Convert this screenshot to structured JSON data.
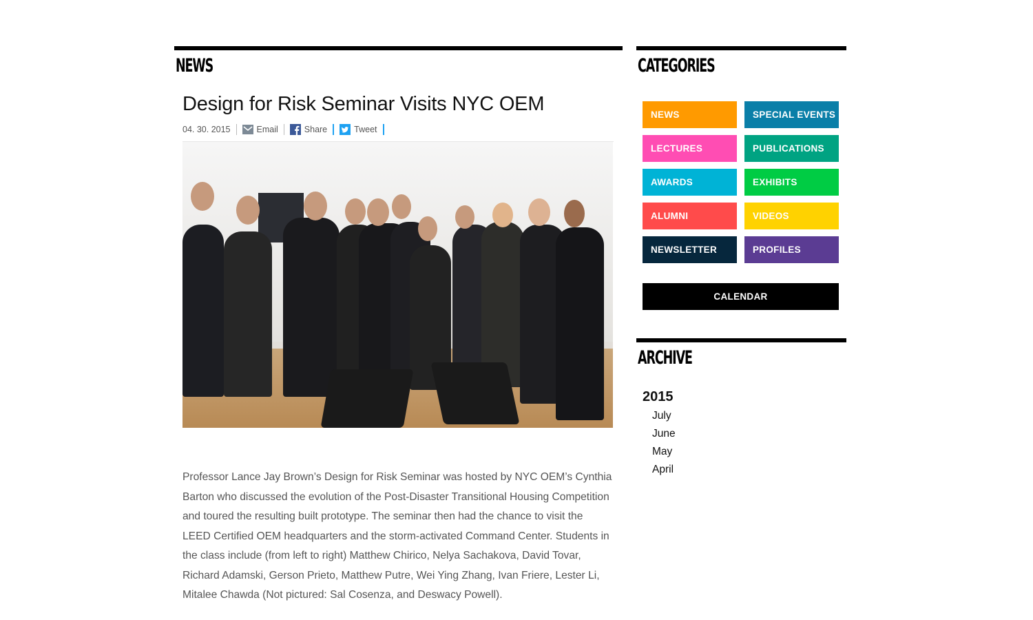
{
  "news": {
    "section_title": "NEWS",
    "article": {
      "title": "Design for Risk Seminar Visits NYC OEM",
      "date": "04. 30. 2015",
      "email_label": "Email",
      "share_label": "Share",
      "tweet_label": "Tweet",
      "body": "Professor Lance Jay Brown’s Design for Risk Seminar was hosted by NYC OEM’s Cynthia Barton who discussed the evolution of the Post-Disaster Transitional Housing Competition and toured the resulting built prototype. The seminar then had the chance to visit the LEED Certified OEM headquarters and the storm-activated Command Center. Students in the class include (from left to right) Matthew Chirico, Nelya Sachakova, David Tovar, Richard Adamski, Gerson Prieto, Matthew Putre, Wei Ying Zhang, Ivan Friere, Lester Li, Mitalee Chawda (Not pictured: Sal Cosenza, and Deswacy Powell)."
    }
  },
  "sidebar": {
    "categories_title": "CATEGORIES",
    "categories": [
      {
        "label": "NEWS",
        "color": "#ff9a00"
      },
      {
        "label": "SPECIAL EVENTS",
        "color": "#0a7fa8"
      },
      {
        "label": "LECTURES",
        "color": "#ff4db3"
      },
      {
        "label": "PUBLICATIONS",
        "color": "#00a382"
      },
      {
        "label": "AWARDS",
        "color": "#00b3d6"
      },
      {
        "label": "EXHIBITS",
        "color": "#00cc44"
      },
      {
        "label": "ALUMNI",
        "color": "#ff4b4b"
      },
      {
        "label": "VIDEOS",
        "color": "#ffd200"
      },
      {
        "label": "NEWSLETTER",
        "color": "#06273d"
      },
      {
        "label": "PROFILES",
        "color": "#5b3c93"
      }
    ],
    "calendar_label": "CALENDAR",
    "archive_title": "ARCHIVE",
    "archive_year": "2015",
    "archive_months": [
      "July",
      "June",
      "May",
      "April"
    ]
  },
  "icons": {
    "email": "envelope-icon",
    "share": "facebook-icon",
    "tweet": "twitter-icon"
  }
}
